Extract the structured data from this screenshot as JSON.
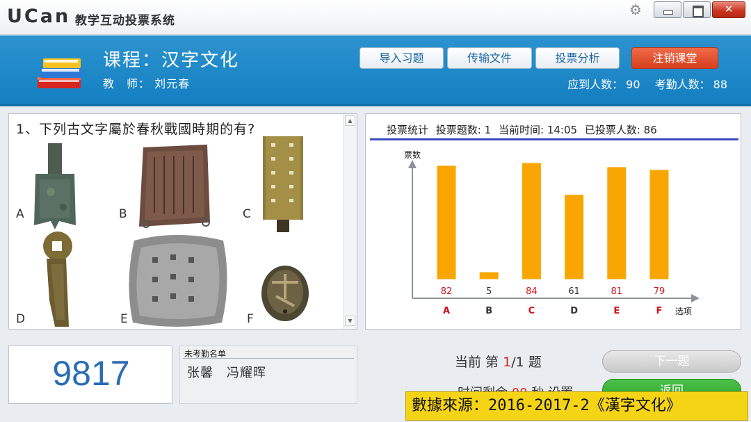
{
  "window": {
    "logo": "UCan",
    "title": "教学互动投票系统"
  },
  "header": {
    "course": "课程：汉字文化",
    "teacher": "教　师：  刘元春",
    "buttons": [
      "导入习题",
      "传输文件",
      "投票分析",
      "注销课堂"
    ],
    "expected_label": "应到人数：",
    "expected_value": "90",
    "attendance_label": "考勤人数：",
    "attendance_value": "88"
  },
  "question": {
    "text": "1、下列古文字屬於春秋戰國時期的有?",
    "options": [
      "A",
      "B",
      "C",
      "D",
      "E",
      "F"
    ]
  },
  "stats": {
    "title": "投票统计",
    "count_label": "投票题数:",
    "count_value": "1",
    "time_label": "当前时间:",
    "time_value": "14:05",
    "voted_label": "已投票人数:",
    "voted_value": "86"
  },
  "chart_data": {
    "type": "bar",
    "categories": [
      "A",
      "B",
      "C",
      "D",
      "E",
      "F"
    ],
    "values": [
      82,
      5,
      84,
      61,
      81,
      79
    ],
    "highlighted": [
      "A",
      "C",
      "E",
      "F"
    ],
    "ylabel": "票数",
    "xlabel": "选项",
    "bar_color": "#f9a602",
    "highlight_color": "#d0121b",
    "grid": false
  },
  "code": "9817",
  "absent": {
    "title": "未考勤名单",
    "names": "张馨　冯耀晖"
  },
  "progress": {
    "label_pre": "当前 第 ",
    "current": "1",
    "total_sep": "/1 题",
    "next_label": "下一题",
    "timer_pre": "时间剩余 ",
    "timer_value": "00",
    "timer_post": " 秒 设置",
    "back_label": "返回"
  },
  "caption": "數據來源：2016-2017-2《漢字文化》"
}
